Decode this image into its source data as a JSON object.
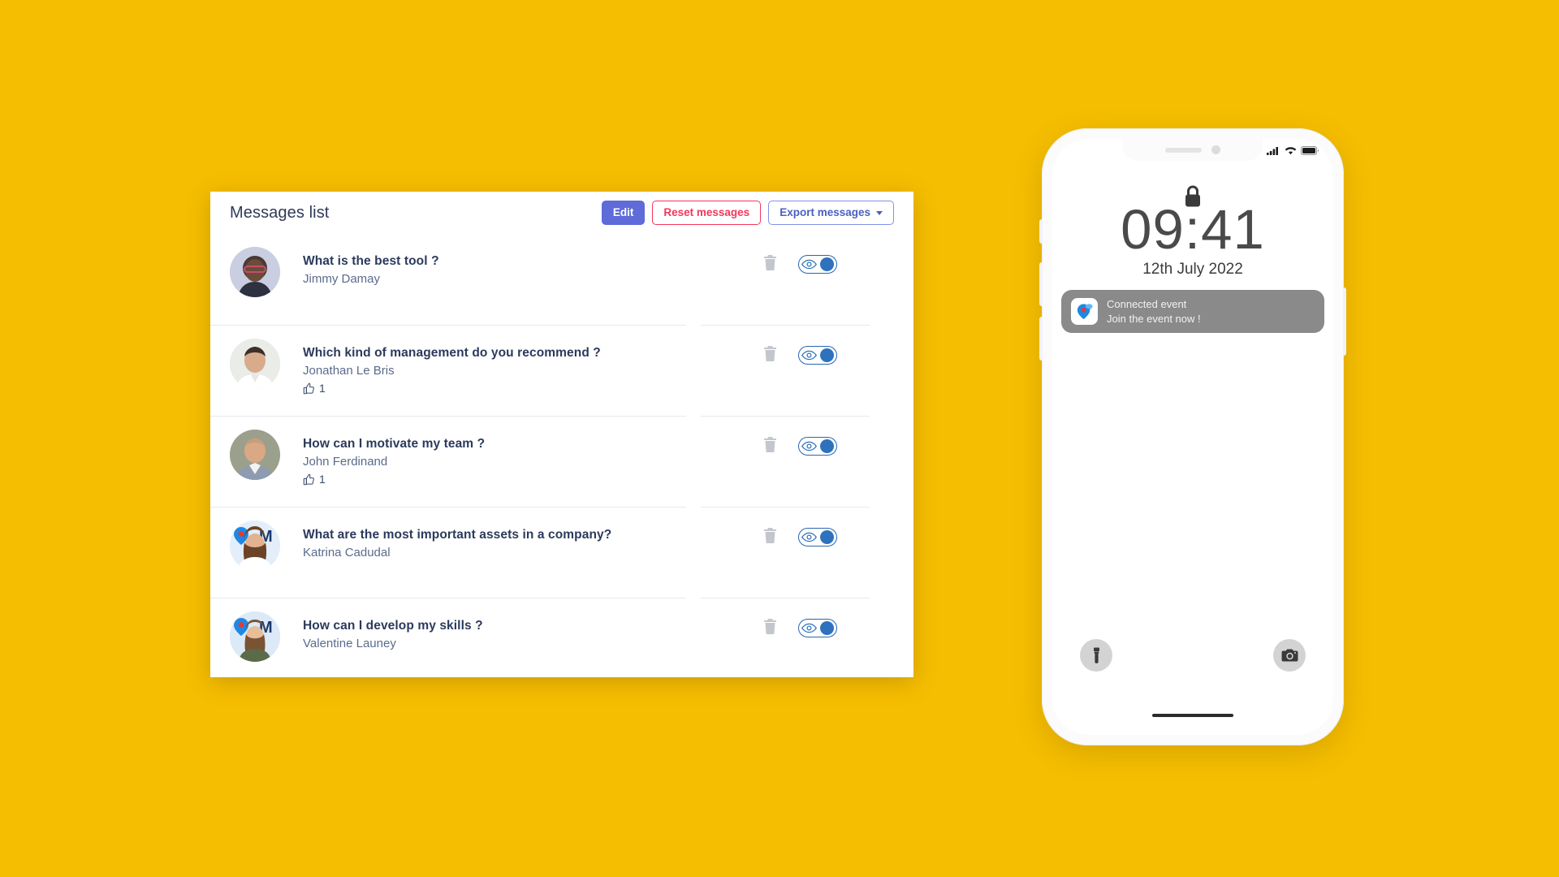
{
  "theme": {
    "background": "#F5BE00",
    "panel_background": "#FFFFFF",
    "title_color": "#2B3A5C",
    "author_color": "#5A6B8C",
    "primary_button": "#5E6BD8",
    "danger_color": "#F5365C",
    "toggle_color": "#2E72BD"
  },
  "panel": {
    "title": "Messages list",
    "actions": {
      "edit_label": "Edit",
      "reset_label": "Reset messages",
      "export_label": "Export messages"
    }
  },
  "messages": [
    {
      "title": "What is the best tool ?",
      "author": "Jimmy Damay",
      "likes": "",
      "has_likes": false,
      "visible": true
    },
    {
      "title": "Which kind of management do you recommend ?",
      "author": "Jonathan Le Bris",
      "likes": "1",
      "has_likes": true,
      "visible": true
    },
    {
      "title": "How can I motivate my team ?",
      "author": "John Ferdinand",
      "likes": "1",
      "has_likes": true,
      "visible": true
    },
    {
      "title": "What are the most important assets in a company?",
      "author": "Katrina Cadudal",
      "likes": "",
      "has_likes": false,
      "visible": true
    },
    {
      "title": "How can I develop my skills ?",
      "author": "Valentine Launey",
      "likes": "",
      "has_likes": false,
      "visible": true
    }
  ],
  "phone": {
    "status_bar": {
      "signal": "signal-bars-icon",
      "wifi": "wifi-icon",
      "battery": "battery-icon"
    },
    "lock_screen": {
      "lock_icon": "lock-icon",
      "time": "09:41",
      "date": "12th July 2022"
    },
    "notification": {
      "app_icon": "location-pin-app-icon",
      "title": "Connected event",
      "body": "Join the event now !"
    },
    "bottom_actions": {
      "flashlight": "flashlight-icon",
      "camera": "camera-icon"
    }
  }
}
